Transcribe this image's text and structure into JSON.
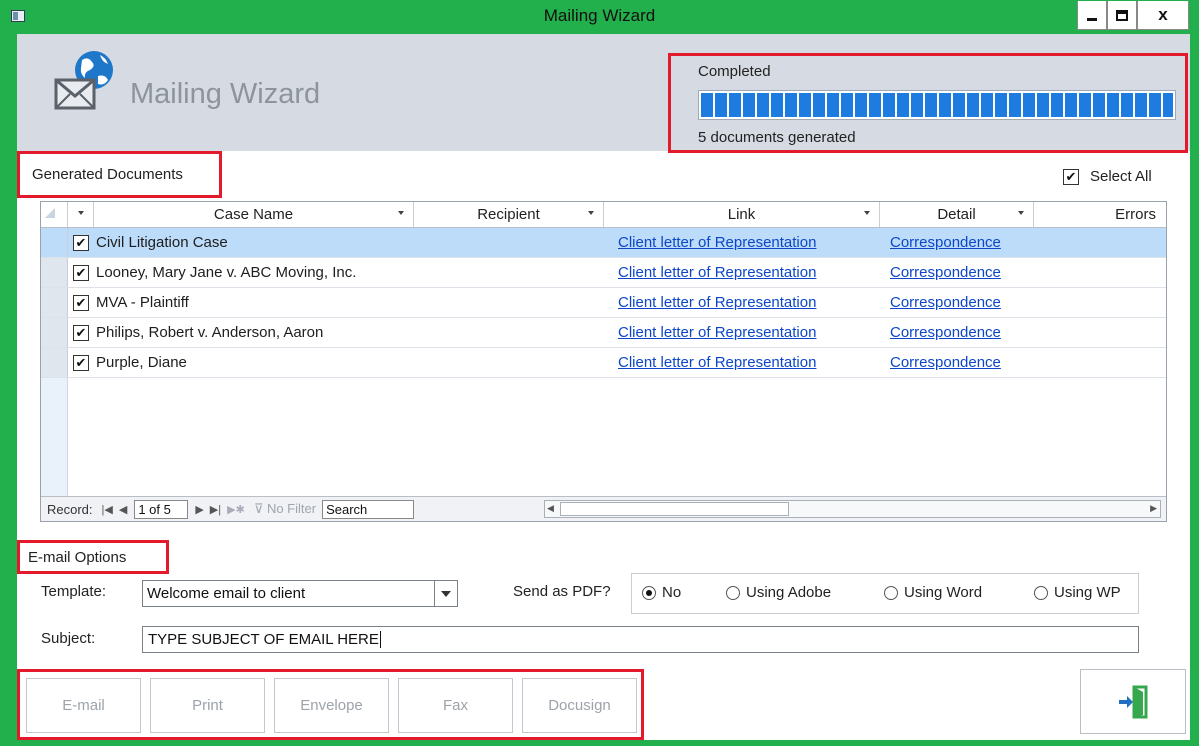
{
  "window": {
    "title": "Mailing Wizard"
  },
  "header": {
    "title": "Mailing Wizard",
    "progress_status": "Completed",
    "progress_fraction": 1.0,
    "documents_generated": "5 documents generated"
  },
  "documents": {
    "section_label": "Generated Documents",
    "select_all_label": "Select All",
    "select_all_checked": true,
    "columns": {
      "case_name": "Case Name",
      "recipient": "Recipient",
      "link": "Link",
      "detail": "Detail",
      "errors": "Errors"
    },
    "rows": [
      {
        "checked": true,
        "case_name": "Civil Litigation Case",
        "recipient": "",
        "link": "Client letter of Representation",
        "detail": "Correspondence",
        "errors": ""
      },
      {
        "checked": true,
        "case_name": "Looney, Mary Jane v. ABC Moving, Inc.",
        "recipient": "",
        "link": "Client letter of Representation",
        "detail": "Correspondence",
        "errors": ""
      },
      {
        "checked": true,
        "case_name": "MVA - Plaintiff",
        "recipient": "",
        "link": "Client letter of Representation",
        "detail": "Correspondence",
        "errors": ""
      },
      {
        "checked": true,
        "case_name": "Philips, Robert v. Anderson, Aaron",
        "recipient": "",
        "link": "Client letter of Representation",
        "detail": "Correspondence",
        "errors": ""
      },
      {
        "checked": true,
        "case_name": "Purple, Diane",
        "recipient": "",
        "link": "Client letter of Representation",
        "detail": "Correspondence",
        "errors": ""
      }
    ],
    "navigation": {
      "record_label": "Record:",
      "current_record": "1 of 5",
      "filter_label": "No Filter",
      "search_label": "Search"
    }
  },
  "email_options": {
    "section_label": "E-mail Options",
    "template_label": "Template:",
    "template_value": "Welcome email to client",
    "send_pdf_label": "Send as PDF?",
    "pdf_options": [
      {
        "label": "No",
        "selected": true
      },
      {
        "label": "Using Adobe",
        "selected": false
      },
      {
        "label": "Using Word",
        "selected": false
      },
      {
        "label": "Using WP",
        "selected": false
      }
    ],
    "subject_label": "Subject:",
    "subject_value": "TYPE SUBJECT OF EMAIL HERE"
  },
  "actions": {
    "email": "E-mail",
    "print": "Print",
    "envelope": "Envelope",
    "fax": "Fax",
    "docusign": "Docusign"
  },
  "icons": {
    "app": "app-window-icon",
    "logo": "globe-envelope-icon",
    "exit": "exit-door-icon"
  },
  "colors": {
    "accent_green": "#21b04b",
    "highlight_red": "#e21a2b",
    "progress_blue": "#1e7be0",
    "link_blue": "#0c46c8",
    "selected_row": "#bcdcfa"
  }
}
